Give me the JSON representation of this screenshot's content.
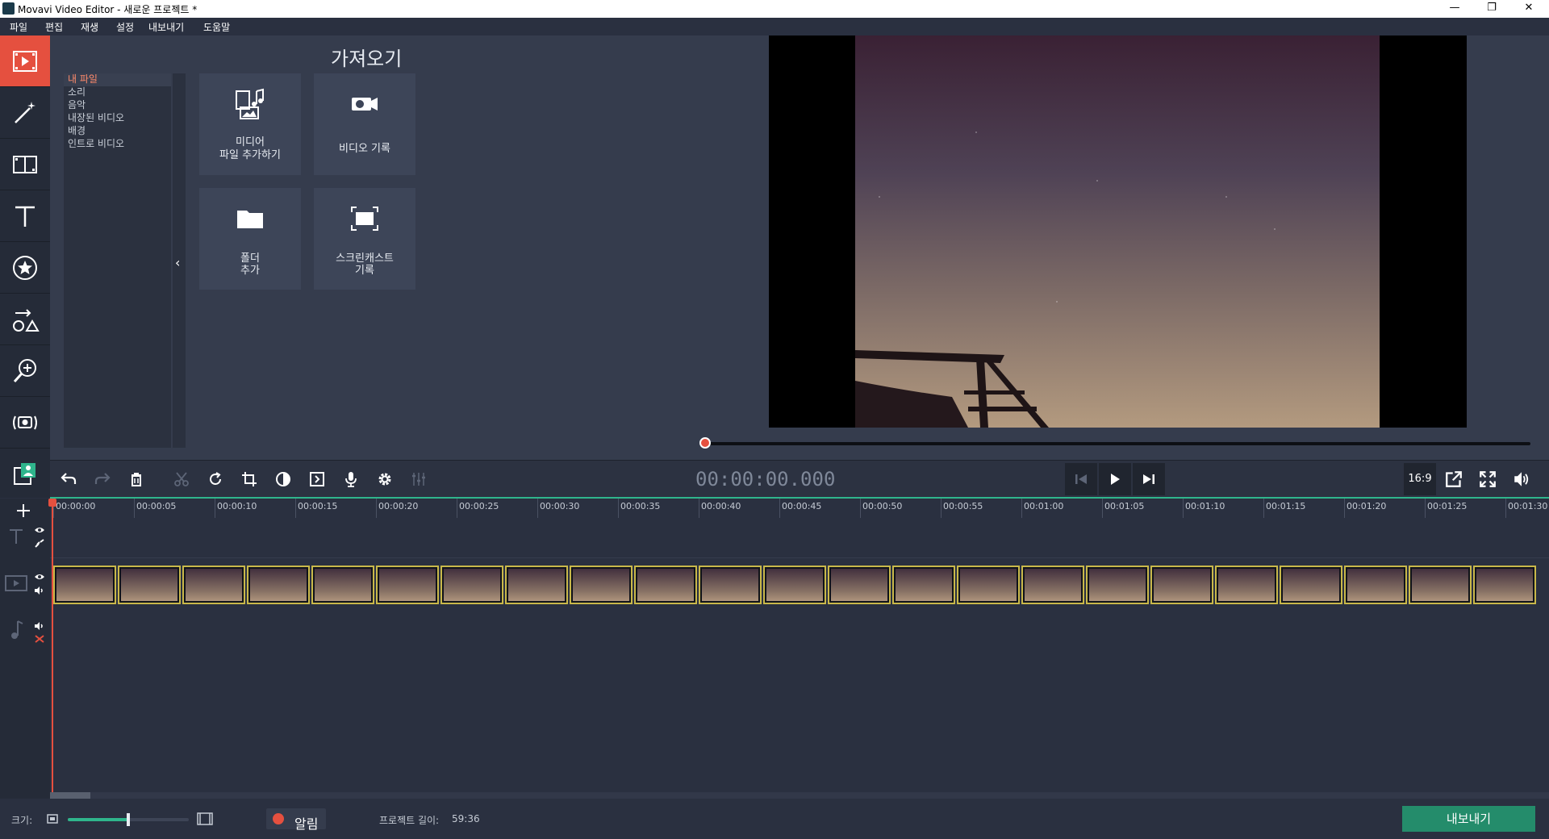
{
  "window": {
    "title": "Movavi Video Editor - 새로운 프로젝트 *",
    "minimize": "—",
    "restore": "❐",
    "close": "✕"
  },
  "menu": [
    "파일",
    "편집",
    "재생",
    "설정",
    "내보내기",
    "도움말"
  ],
  "import": {
    "title": "가져오기",
    "categories": [
      {
        "label": "내 파일",
        "selected": true
      },
      {
        "label": "소리",
        "selected": false
      },
      {
        "label": "음악",
        "selected": false
      },
      {
        "label": "내장된 비디오",
        "selected": false
      },
      {
        "label": "배경",
        "selected": false
      },
      {
        "label": "인트로 비디오",
        "selected": false
      }
    ],
    "tiles": {
      "add_media": {
        "line1": "미디어",
        "line2": "파일 추가하기"
      },
      "record_video": {
        "line1": "비디오 기록"
      },
      "add_folder": {
        "line1": "폴더",
        "line2": "추가"
      },
      "screencast": {
        "line1": "스크린캐스트",
        "line2": "기록"
      }
    }
  },
  "player": {
    "timecode": "00:00:00.000",
    "aspect": "16:9",
    "progress": 0
  },
  "timeline": {
    "ruler": [
      "00:00:00",
      "00:00:05",
      "00:00:10",
      "00:00:15",
      "00:00:20",
      "00:00:25",
      "00:00:30",
      "00:00:35",
      "00:00:40",
      "00:00:45",
      "00:00:50",
      "00:00:55",
      "00:01:00",
      "00:01:05",
      "00:01:10",
      "00:01:15",
      "00:01:20",
      "00:01:25",
      "00:01:30"
    ],
    "clip_frames": 23
  },
  "status": {
    "size_label": "크기:",
    "zoom_level": 0.5,
    "alarm_label": "알림",
    "project_length_label": "프로젝트 길이:",
    "project_length": "59:36",
    "export_label": "내보내기"
  },
  "colors": {
    "accent": "#e5503f",
    "green": "#2fb58c",
    "export": "#248c6b"
  }
}
